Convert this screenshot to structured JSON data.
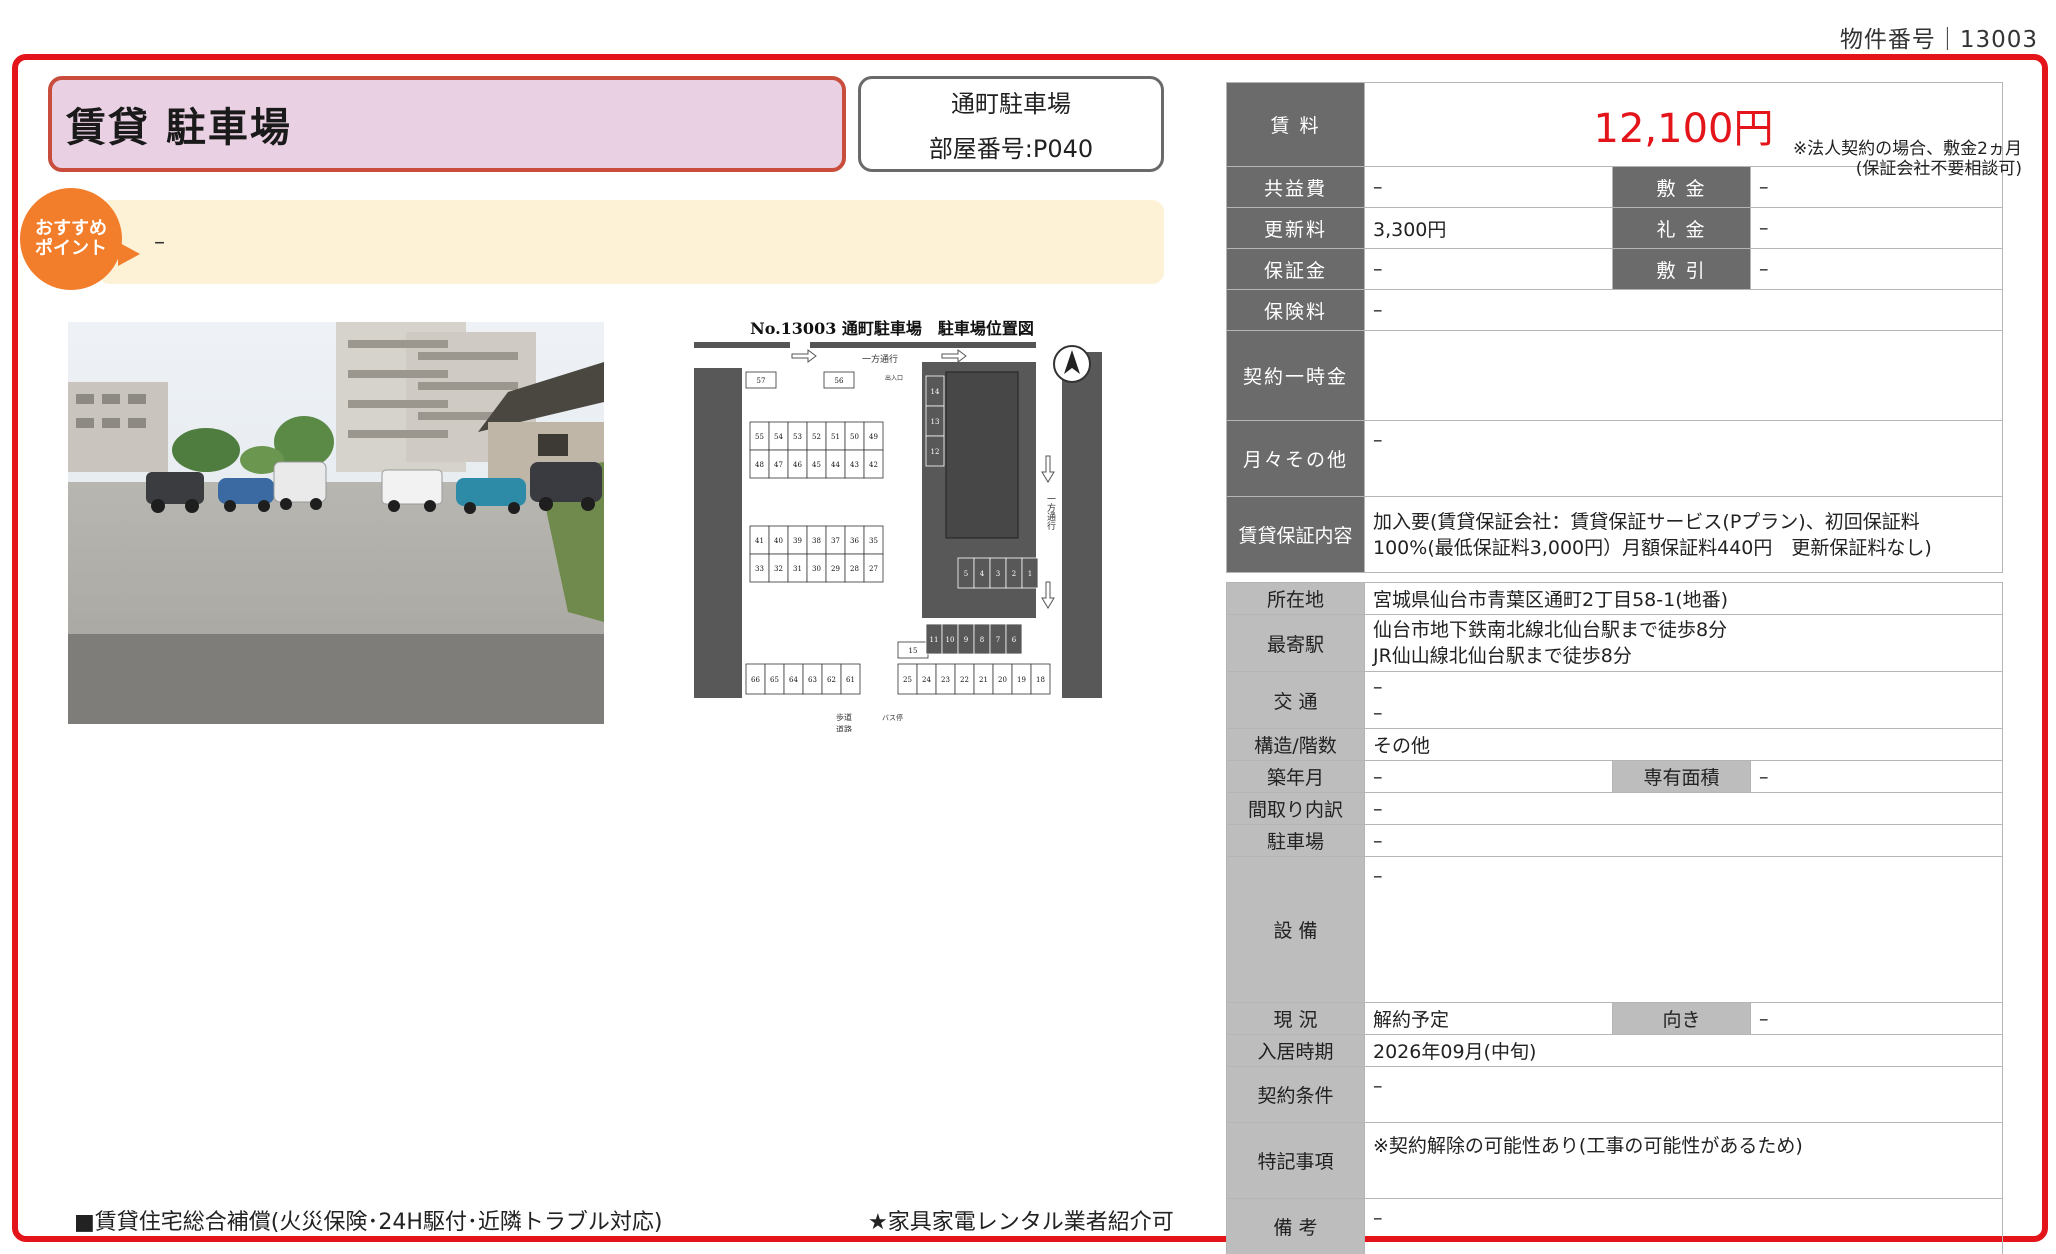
{
  "header": {
    "property_number": "物件番号｜13003"
  },
  "title": {
    "main": "賃貸 駐車場",
    "building": "通町駐車場",
    "room": "部屋番号:P040"
  },
  "recommend": {
    "badge_line1": "おすすめ",
    "badge_line2": "ポイント",
    "text": "–"
  },
  "map": {
    "title": "No.13003 通町駐車場　駐車場位置図",
    "one_way": "一方通行",
    "one_way_vertical": "一方通行",
    "sidewalk": "歩道",
    "road": "道路",
    "bus_stop": "バス停",
    "entrance": "出入口",
    "spots_top": [
      "57",
      "56"
    ],
    "spots_row1": [
      "55",
      "54",
      "53",
      "52",
      "51",
      "50",
      "49"
    ],
    "spots_row2": [
      "48",
      "47",
      "46",
      "45",
      "44",
      "43",
      "42"
    ],
    "spots_row3": [
      "41",
      "40",
      "39",
      "38",
      "37",
      "36",
      "35"
    ],
    "spots_row4": [
      "33",
      "32",
      "31",
      "30",
      "29",
      "28",
      "27"
    ],
    "spots_bottom_left": [
      "66",
      "65",
      "64",
      "63",
      "62",
      "61"
    ],
    "spots_bottom_right": [
      "25",
      "24",
      "23",
      "22",
      "21",
      "20",
      "19",
      "18"
    ],
    "spots_right_col": [
      "14",
      "13",
      "12"
    ],
    "spots_right_mid": [
      "5",
      "4",
      "3",
      "2",
      "1"
    ],
    "spots_right_low": [
      "11",
      "10",
      "9",
      "8",
      "7",
      "6"
    ],
    "spot_single": "15"
  },
  "rent": {
    "rent_label": "賃 料",
    "rent_value": "12,100円",
    "rent_note_1": "※法人契約の場合、敷金2ヵ月",
    "rent_note_2": "(保証会社不要相談可)",
    "common_fee_label": "共益費",
    "common_fee": "–",
    "deposit_label": "敷 金",
    "deposit": "–",
    "renewal_label": "更新料",
    "renewal": "3,300円",
    "key_money_label": "礼 金",
    "key_money": "–",
    "guarantee_label": "保証金",
    "guarantee": "–",
    "amortization_label": "敷 引",
    "amortization": "–",
    "insurance_label": "保険料",
    "insurance": "–",
    "lump_sum_label": "契約一時金",
    "lump_sum": "",
    "monthly_other_label": "月々その他",
    "monthly_other": "–",
    "guarantor_label": "賃貸保証内容",
    "guarantor_line1": "加入要(賃貸保証会社：賃貸保証サービス(Pプラン)、初回保証料",
    "guarantor_line2": "100%(最低保証料3,000円）月額保証料440円　更新保証料なし)"
  },
  "details": {
    "address_label": "所在地",
    "address": "宮城県仙台市青葉区通町2丁目58-1(地番)",
    "station_label": "最寄駅",
    "station_line1": "仙台市地下鉄南北線北仙台駅まで徒歩8分",
    "station_line2": "JR仙山線北仙台駅まで徒歩8分",
    "transport_label": "交 通",
    "transport_line1": "–",
    "transport_line2": "–",
    "structure_label": "構造/階数",
    "structure": "その他",
    "built_label": "築年月",
    "built": "–",
    "area_label": "専有面積",
    "area": "–",
    "layout_label": "間取り内訳",
    "layout": "–",
    "parking_label": "駐車場",
    "parking": "–",
    "equipment_label": "設 備",
    "equipment": "–",
    "status_label": "現 況",
    "status": "解約予定",
    "direction_label": "向き",
    "direction": "–",
    "move_in_label": "入居時期",
    "move_in": "2026年09月(中旬)",
    "conditions_label": "契約条件",
    "conditions": "–",
    "special_label": "特記事項",
    "special": "※契約解除の可能性あり(工事の可能性があるため)",
    "remarks_label": "備 考",
    "remarks": "–"
  },
  "footer": {
    "left": "■賃貸住宅総合補償(火災保険･24H駆付･近隣トラブル対応)",
    "right": "★家具家電レンタル業者紹介可"
  }
}
